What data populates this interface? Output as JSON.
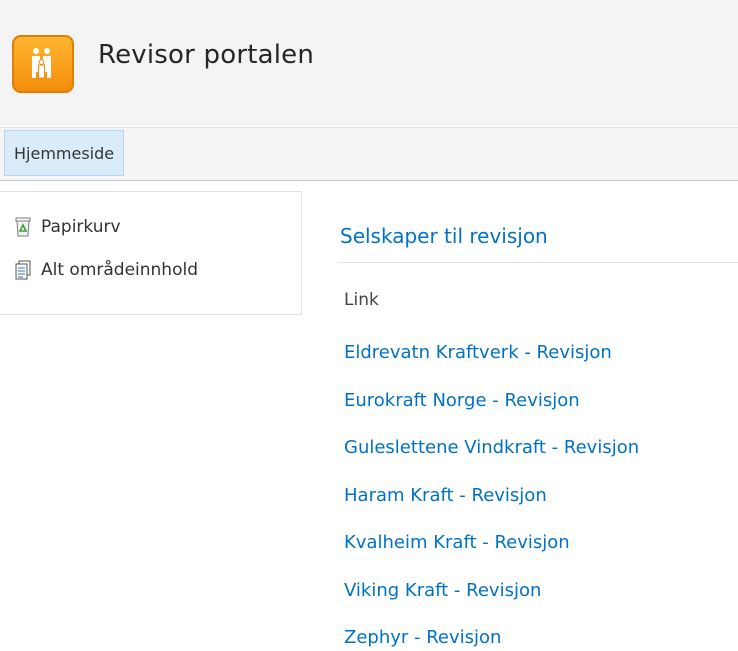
{
  "header": {
    "site_title": "Revisor portalen",
    "logo_icon": "site-people-icon"
  },
  "topnav": {
    "tabs": [
      {
        "label": "Hjemmeside",
        "selected": true
      }
    ]
  },
  "quicklaunch": {
    "items": [
      {
        "label": "Papirkurv",
        "icon": "recycle-bin-icon"
      },
      {
        "label": "Alt områdeinnhold",
        "icon": "site-contents-icon"
      }
    ]
  },
  "main": {
    "web_part_title": "Selskaper til revisjon",
    "column_header": "Link",
    "links": [
      "Eldrevatn Kraftverk - Revisjon",
      "Eurokraft Norge - Revisjon",
      "Guleslettene Vindkraft - Revisjon",
      "Haram Kraft - Revisjon",
      "Kvalheim Kraft - Revisjon",
      "Viking Kraft - Revisjon",
      "Zephyr - Revisjon"
    ]
  },
  "colors": {
    "link": "#0072c6",
    "logo_orange": "#f5920f",
    "selected_tab": "#daebf9",
    "header_bg": "#f4f4f4"
  }
}
